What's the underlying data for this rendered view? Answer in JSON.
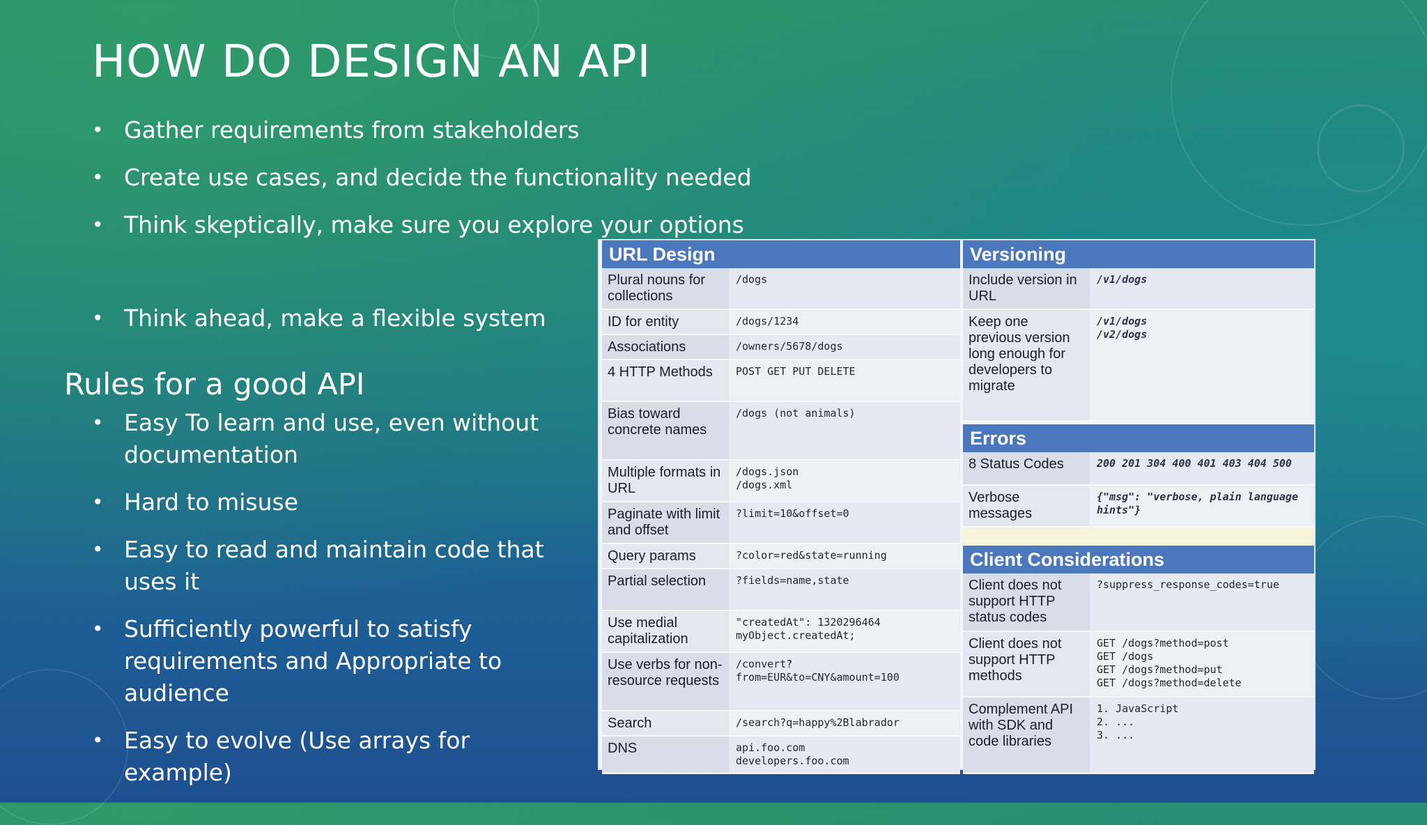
{
  "slide": {
    "title": "HOW DO DESIGN AN API",
    "top_bullets": [
      "Gather requirements from stakeholders",
      "Create use cases, and decide the functionality needed",
      "Think skeptically, make sure you explore your options"
    ],
    "bullet_flexible": "Think ahead, make a flexible system",
    "rules_heading": "Rules for a good API",
    "rules_bullets": [
      "Easy To learn and use, even without documentation",
      "Hard to misuse",
      "Easy to read and maintain code that uses it",
      "Sufficiently powerful to satisfy requirements and Appropriate to audience",
      "Easy to evolve (Use arrays for example)"
    ]
  },
  "table": {
    "url_design": {
      "heading": "URL Design",
      "rows": [
        {
          "k": "Plural nouns for collections",
          "v": "/dogs"
        },
        {
          "k": "ID for entity",
          "v": "/dogs/1234"
        },
        {
          "k": "Associations",
          "v": "/owners/5678/dogs"
        },
        {
          "k": "4 HTTP Methods",
          "v": "POST GET PUT DELETE"
        },
        {
          "k": "Bias toward concrete names",
          "v": "/dogs (not animals)"
        },
        {
          "k": "Multiple formats in URL",
          "v": "/dogs.json\n/dogs.xml"
        },
        {
          "k": "Paginate with limit and offset",
          "v": "?limit=10&offset=0"
        },
        {
          "k": "Query params",
          "v": "?color=red&state=running"
        },
        {
          "k": "Partial selection",
          "v": "?fields=name,state"
        },
        {
          "k": "Use medial capitalization",
          "v": "\"createdAt\": 1320296464\nmyObject.createdAt;"
        },
        {
          "k": "Use verbs for non-resource requests",
          "v": "/convert?\nfrom=EUR&to=CNY&amount=100"
        },
        {
          "k": "Search",
          "v": "/search?q=happy%2Blabrador"
        },
        {
          "k": "DNS",
          "v": "api.foo.com\ndevelopers.foo.com"
        }
      ]
    },
    "versioning": {
      "heading": "Versioning",
      "rows": [
        {
          "k": "Include version in URL",
          "v": "/v1/dogs"
        },
        {
          "k": "Keep one previous version long enough for developers to migrate",
          "v": "/v1/dogs\n/v2/dogs"
        }
      ]
    },
    "errors": {
      "heading": "Errors",
      "rows": [
        {
          "k": "8 Status Codes",
          "v": "200 201 304 400 401 403 404 500"
        },
        {
          "k": "Verbose messages",
          "v": "{\"msg\": \"verbose, plain language hints\"}"
        }
      ]
    },
    "client": {
      "heading": "Client Considerations",
      "rows": [
        {
          "k": "Client does not support HTTP status codes",
          "v": "?suppress_response_codes=true"
        },
        {
          "k": "Client does not support HTTP methods",
          "v": "GET /dogs?method=post\nGET /dogs\nGET /dogs?method=put\nGET /dogs?method=delete"
        },
        {
          "k": "Complement API with SDK and code libraries",
          "v": "1. JavaScript\n2. ...\n3. ..."
        }
      ]
    }
  }
}
